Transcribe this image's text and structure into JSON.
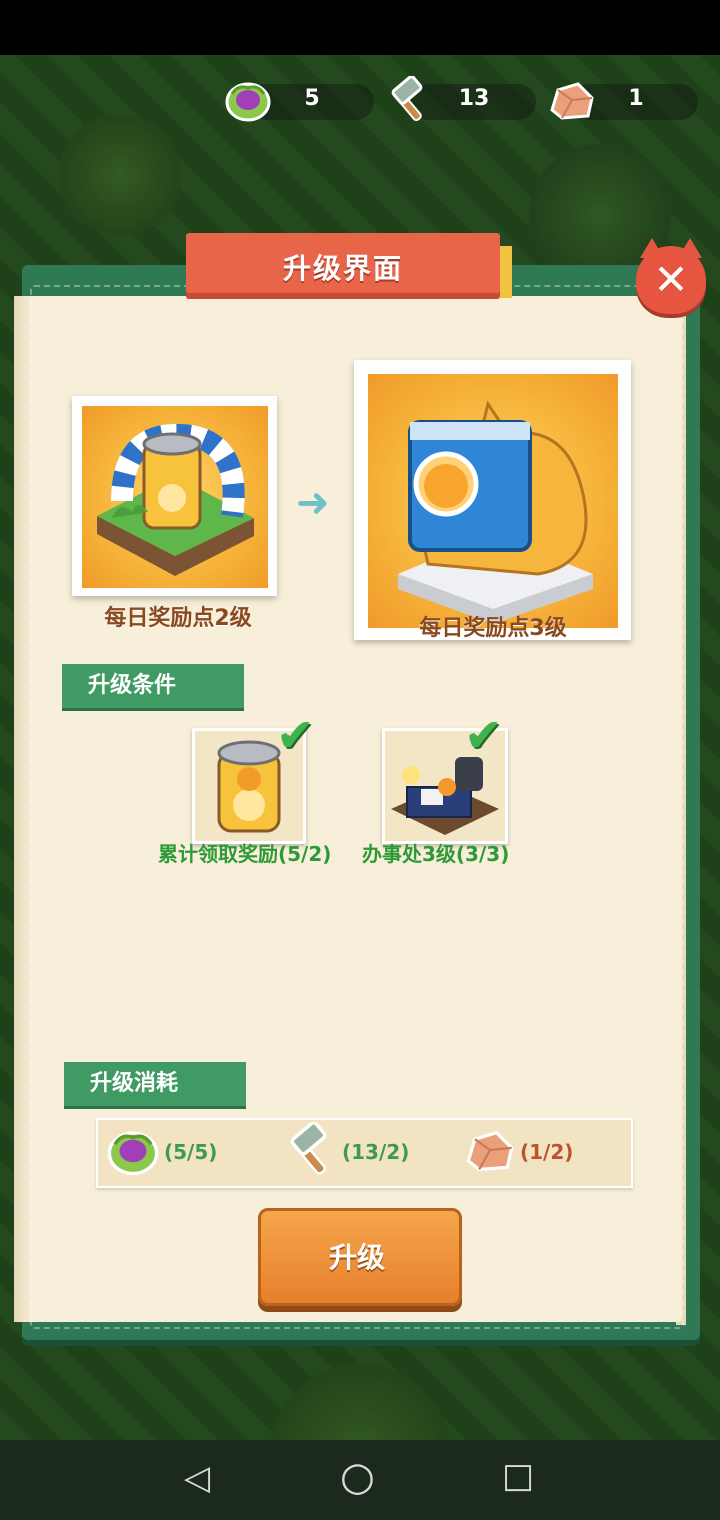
{
  "resources": {
    "cabbage_count": "5",
    "hammer_count": "13",
    "stone_count": "1"
  },
  "dialog": {
    "title": "升级界面",
    "close_symbol": "✕"
  },
  "upgrade": {
    "from_label": "每日奖励点2级",
    "to_label": "每日奖励点3级",
    "arrow": "➜"
  },
  "conditions": {
    "section_label": "升级条件",
    "items": [
      {
        "label": "累计领取奖励(5/2)",
        "met": true
      },
      {
        "label": "办事处3级(3/3)",
        "met": true
      }
    ]
  },
  "cost": {
    "section_label": "升级消耗",
    "items": [
      {
        "icon": "cabbage-icon",
        "value": "(5/5)",
        "sufficient": true
      },
      {
        "icon": "hammer-icon",
        "value": "(13/2)",
        "sufficient": true
      },
      {
        "icon": "stone-icon",
        "value": "(1/2)",
        "sufficient": false
      }
    ]
  },
  "button": {
    "upgrade_label": "升级"
  },
  "navbar": {
    "back": "◁",
    "home": "○",
    "recents": "□"
  },
  "colors": {
    "panel_green": "#2f7a54",
    "title_red": "#e8654a",
    "ok_green": "#2e9a37",
    "lack_brown": "#b9542f",
    "button_orange": "#e6802e"
  }
}
